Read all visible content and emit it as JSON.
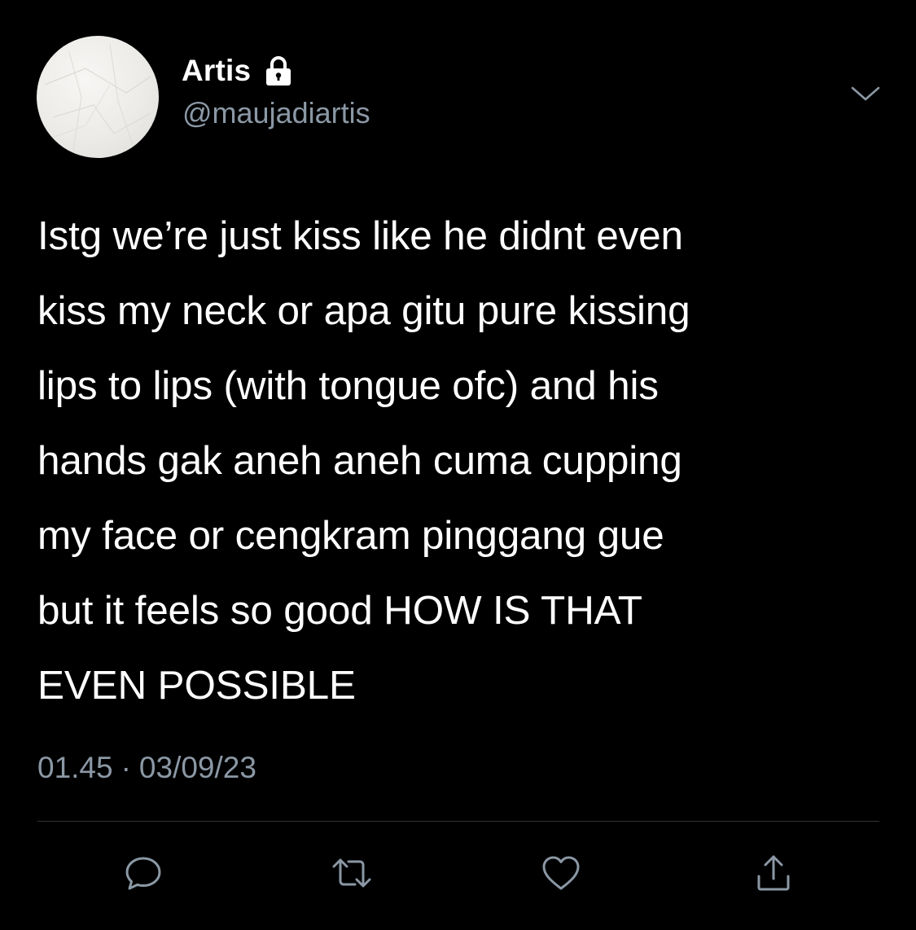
{
  "author": {
    "display_name": "Artis",
    "handle": "@maujadiartis",
    "protected_icon": "lock-icon",
    "avatar_icon": "avatar"
  },
  "menu": {
    "icon": "chevron-down-icon"
  },
  "tweet": {
    "text_lines": [
      "Istg we’re just kiss like he didnt even",
      "kiss my neck or apa gitu pure kissing",
      "lips to lips (with tongue ofc) and his",
      "hands gak aneh aneh cuma cupping",
      "my face or cengkram pinggang gue",
      "but it feels so good HOW IS THAT",
      "EVEN POSSIBLE"
    ],
    "time": "01.45",
    "separator": "·",
    "date": "03/09/23"
  },
  "actions": [
    {
      "name": "reply",
      "icon": "reply-icon"
    },
    {
      "name": "retweet",
      "icon": "retweet-icon"
    },
    {
      "name": "like",
      "icon": "heart-icon"
    },
    {
      "name": "share",
      "icon": "share-icon"
    }
  ],
  "colors": {
    "background": "#000000",
    "text": "#ffffff",
    "secondary": "#8b98a5",
    "divider": "#2f3336"
  }
}
